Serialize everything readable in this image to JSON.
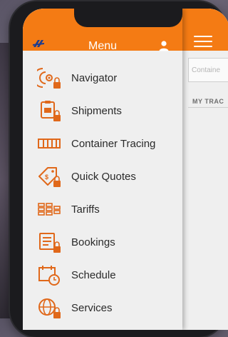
{
  "drawer": {
    "title": "Menu",
    "logo_icon": "carrier-logo-icon",
    "user_icon": "user-icon",
    "items": [
      {
        "label": "Navigator",
        "icon": "navigator-icon",
        "locked": true
      },
      {
        "label": "Shipments",
        "icon": "shipments-icon",
        "locked": true
      },
      {
        "label": "Container Tracing",
        "icon": "container-icon",
        "locked": false
      },
      {
        "label": "Quick Quotes",
        "icon": "quote-tag-icon",
        "locked": true
      },
      {
        "label": "Tariffs",
        "icon": "tariffs-icon",
        "locked": false
      },
      {
        "label": "Bookings",
        "icon": "bookings-icon",
        "locked": true
      },
      {
        "label": "Schedule",
        "icon": "schedule-icon",
        "locked": false
      },
      {
        "label": "Services",
        "icon": "services-icon",
        "locked": true
      }
    ]
  },
  "main": {
    "hamburger_icon": "hamburger-menu-icon",
    "search_placeholder": "Containe",
    "section_label": "MY TRAC"
  },
  "colors": {
    "accent": "#f47b14",
    "logo": "#1d3c8f",
    "icon": "#e0681a"
  }
}
